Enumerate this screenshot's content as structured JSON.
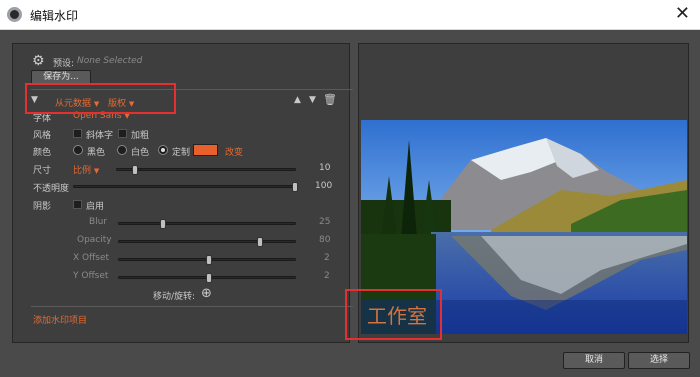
{
  "window": {
    "title": "编辑水印"
  },
  "preset": {
    "label": "预设:",
    "value": "None Selected",
    "save_as": "保存为..."
  },
  "header": {
    "source": "从元数据",
    "field": "版权"
  },
  "font": {
    "label": "字体",
    "value": "Open Sans"
  },
  "style": {
    "label": "风格",
    "italic": "斜体字",
    "bold": "加粗"
  },
  "color": {
    "label": "颜色",
    "black": "黑色",
    "white": "白色",
    "custom": "定制",
    "change": "改变",
    "swatch": "#e8612c",
    "selected": "custom"
  },
  "size": {
    "label": "尺寸",
    "mode": "比例",
    "value": "10",
    "fraction": 0.1
  },
  "opacity": {
    "label": "不透明度",
    "value": "100",
    "fraction": 1.0
  },
  "shadow": {
    "label": "阴影",
    "enable": "启用",
    "blur": {
      "label": "Blur",
      "value": "25",
      "fraction": 0.25
    },
    "opacity": {
      "label": "Opacity",
      "value": "80",
      "fraction": 0.8
    },
    "x_offset": {
      "label": "X Offset",
      "value": "2",
      "fraction": 0.51
    },
    "y_offset": {
      "label": "Y Offset",
      "value": "2",
      "fraction": 0.51
    }
  },
  "move_rotate": {
    "label": "移动/旋转:"
  },
  "add_item": "添加水印项目",
  "preview": {
    "watermark_text": "工作室"
  },
  "buttons": {
    "cancel": "取消",
    "select": "选择"
  },
  "colors": {
    "accent": "#e66a32",
    "highlight_box": "#e63030"
  }
}
